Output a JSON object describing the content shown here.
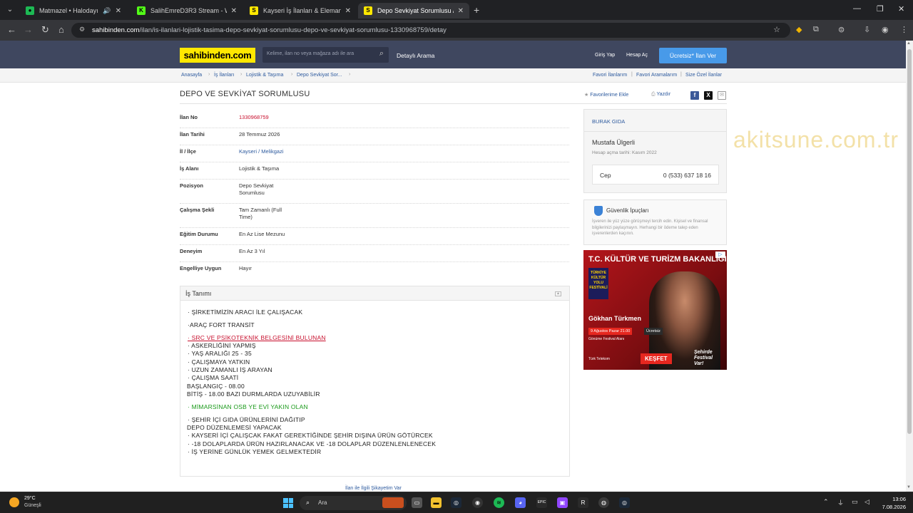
{
  "browser": {
    "tabs": [
      {
        "title": "Matmazel • Halodayı",
        "icon": "spotify-icon",
        "color": "#1db954",
        "glyph": "●"
      },
      {
        "title": "SalihEmreD3R3 Stream - Watch",
        "icon": "kick-icon",
        "color": "#53fc18",
        "glyph": "K"
      },
      {
        "title": "Kayseri İş İlanları & Eleman Ara",
        "icon": "sahibinden-favicon",
        "color": "#ffe800",
        "glyph": "S"
      },
      {
        "title": "Depo Sevkiyat Sorumlusu / DEP",
        "icon": "sahibinden-favicon",
        "color": "#ffe800",
        "glyph": "S"
      }
    ],
    "url_host": "sahibinden.com",
    "url_path": "/ilan/is-ilanlari-lojistik-tasima-depo-sevkiyat-sorumlusu-depo-ve-sevkiyat-sorumlusu-1330968759/detay"
  },
  "header": {
    "logo": "sahibinden.com",
    "search_placeholder": "Kelime, ilan no veya mağaza adı ile ara",
    "advanced_search": "Detaylı Arama",
    "login": "Giriş Yap",
    "register": "Hesap Aç",
    "post_ad": "Ücretsiz* İlan Ver"
  },
  "breadcrumb": {
    "items": [
      "Anasayfa",
      "İş İlanları",
      "Lojistik & Taşıma",
      "Depo Sevkiyat Sor..."
    ],
    "right": [
      "Favori İlanlarım",
      "Favori Aramalarım",
      "Size Özel İlanlar"
    ]
  },
  "listing": {
    "title": "DEPO VE SEVKİYAT SORUMLUSU",
    "add_favorite": "Favorilerime Ekle",
    "print": "Yazdır",
    "details": [
      {
        "key": "İlan No",
        "value": "1330968759"
      },
      {
        "key": "İlan Tarihi",
        "value": "28 Temmuz 2026"
      },
      {
        "key": "İl / İlçe",
        "value": "Kayseri / Melikgazi"
      },
      {
        "key": "İş Alanı",
        "value": "Lojistik & Taşıma"
      },
      {
        "key": "Pozisyon",
        "value": "Depo Sevkiyat Sorumlusu"
      },
      {
        "key": "Çalışma Şekli",
        "value": "Tam Zamanlı (Full Time)"
      },
      {
        "key": "Eğitim Durumu",
        "value": "En Az Lise Mezunu"
      },
      {
        "key": "Deneyim",
        "value": "En Az 3 Yıl"
      },
      {
        "key": "Engelliye Uygun",
        "value": "Hayır"
      }
    ]
  },
  "description": {
    "heading": "İş Tanımı",
    "lines": [
      "· ŞİRKETİMİZİN ARACI İLE ÇALIŞACAK",
      "·ARAÇ FORT TRANSİT",
      "· SRC VE PSİKOTEKNİK BELGESİNİ BULUNAN",
      "· ASKERLİĞİNİ YAPMIŞ",
      "· YAŞ ARALIĞI 25 - 35",
      "· ÇALIŞMAYA YATKIN",
      "· UZUN ZAMANLI İŞ ARAYAN",
      "· ÇALIŞMA SAATİ",
      "BAŞLANGIÇ - 08.00",
      "BİTİŞ - 18.00 BAZI DURMLARDA UZUYABİLİR",
      "· MİMARSİNAN OSB YE EVİ YAKIN OLAN",
      "· ŞEHİR İÇİ GIDA ÜRÜNLERİNİ DAĞITIP",
      "DEPO DÜZENLEMESİ YAPACAK",
      "· KAYSERİ İÇİ ÇALIŞCAK FAKAT GEREKTİĞİNDE ŞEHİR DIŞINA ÜRÜN GÖTÜRCEK",
      "· -18 DOLAPLARDA ÜRÜN HAZIRLANACAK VE -18 DOLAPLAR DÜZENLENLENECEK",
      "· İŞ YERİNE GÜNLÜK YEMEK GELMEKTEDİR"
    ],
    "complaint_link": "İlan ile İlgili Şikayetim Var"
  },
  "seller": {
    "store": "BURAK GIDA",
    "name": "Mustafa Ülgerli",
    "since": "Hesap açma tarihi: Kasım 2022",
    "phone_label": "Cep",
    "phone": "0 (533) 637 18 16"
  },
  "safety": {
    "title": "Güvenlik İpuçları",
    "body": "İşveren ile yüz yüze görüşmeyi tercih edin. Kişisel ve finansal bilgilerinizi paylaşmayın. Herhangi bir ödeme talep eden işverenlerden kaçının."
  },
  "ad": {
    "title": "T.C. KÜLTÜR VE TURİZM BAKANLIĞI",
    "fest_badge": "TÜRKİYE KÜLTÜR YOLU FESTİVALİ",
    "performer": "Gökhan Türkmen",
    "date": "9 Ağustos Pazar 21.00",
    "free": "Ücretsiz",
    "venue": "Gönüme Festival Alanı",
    "cta": "KEŞFET",
    "sponsor": "Türk Telekom",
    "script": "Şehirde Festival Var!"
  },
  "watermark": "akitsune.com.tr",
  "taskbar": {
    "temp": "29°C",
    "weather": "Güneşli",
    "search": "Ara",
    "time": "13:06",
    "date": "7.08.2026"
  }
}
